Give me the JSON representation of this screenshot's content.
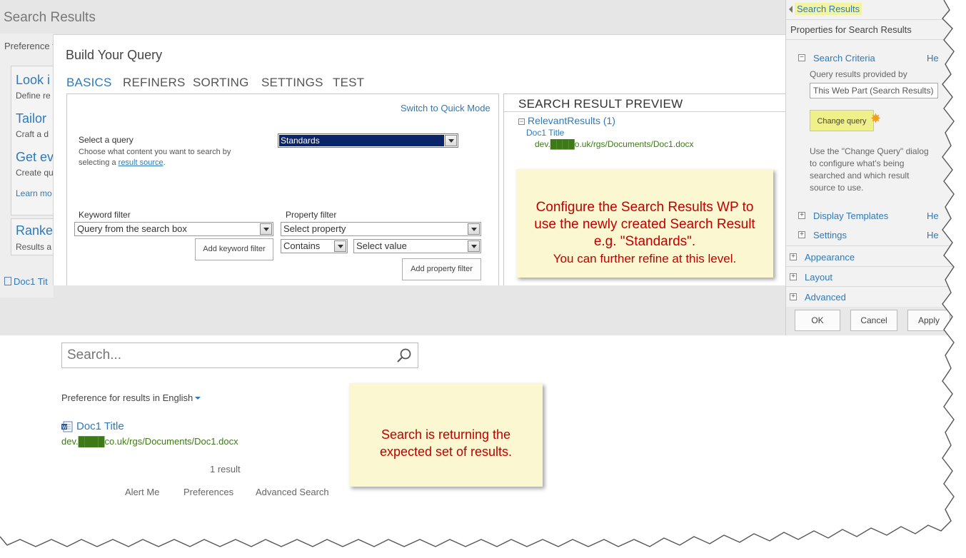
{
  "background_page": {
    "title": "Search Results",
    "preference_label": "Preference f",
    "cards": [
      {
        "heading": "Look i",
        "sub": "Define re"
      },
      {
        "heading": "Tailor",
        "sub": "Craft a d"
      },
      {
        "heading": "Get ev",
        "sub": "Create qu"
      }
    ],
    "learn_more": "Learn mo",
    "rank_heading": "Ranke",
    "rank_sub": "Results a",
    "doc_link": "Doc1 Tit"
  },
  "dialog": {
    "title": "Build Your Query",
    "tabs": [
      {
        "label": "BASICS",
        "active": true
      },
      {
        "label": "REFINERS",
        "active": false
      },
      {
        "label": "SORTING",
        "active": false
      },
      {
        "label": "SETTINGS",
        "active": false
      },
      {
        "label": "TEST",
        "active": false
      }
    ],
    "switch_mode": "Switch to Quick Mode",
    "select_query_label": "Select a query",
    "select_query_desc": "Choose what content you want to search by selecting a",
    "result_source_link": "result source",
    "select_query_value": "Standards",
    "keyword_filter_label": "Keyword filter",
    "keyword_filter_value": "Query from the search box",
    "add_keyword_filter": "Add keyword filter",
    "property_filter_label": "Property filter",
    "property_filter_value": "Select property",
    "operator_value": "Contains",
    "value_value": "Select value",
    "add_property_filter": "Add property filter",
    "preview": {
      "title": "SEARCH RESULT PREVIEW",
      "group": "RelevantResults (1)",
      "doc_title": "Doc1 Title",
      "doc_url": "dev.████o.uk/rgs/Documents/Doc1.docx"
    }
  },
  "tool_pane": {
    "header": "Search Results",
    "properties_title": "Properties for Search Results",
    "search_criteria": "Search Criteria",
    "help_link": "He",
    "query_provided_label": "Query results provided by",
    "query_provided_value": "This Web Part (Search Results)",
    "change_query": "Change query",
    "description": "Use the \"Change Query\" dialog to configure what's being searched and which result source to use.",
    "display_templates": "Display Templates",
    "settings": "Settings",
    "appearance": "Appearance",
    "layout": "Layout",
    "advanced": "Advanced",
    "ok": "OK",
    "cancel": "Cancel",
    "apply": "Apply"
  },
  "search_page": {
    "search_placeholder": "Search...",
    "preference_text": "Preference for results in English",
    "result_title": "Doc1 Title",
    "result_url": "dev.████co.uk/rgs/Documents/Doc1.docx",
    "result_count": "1 result",
    "footer_links": [
      "Alert Me",
      "Preferences",
      "Advanced Search"
    ]
  },
  "notes": {
    "note1_line1": "Configure the Search Results WP to",
    "note1_line2": "use the newly created Search Result",
    "note1_line3": "e.g. \"Standards\".",
    "note1_line4": "You can further refine at this level.",
    "note2_line1": "Search is returning the",
    "note2_line2": "expected set of results."
  },
  "colors": {
    "link_blue": "#2f79b8",
    "url_green": "#3d7a17",
    "note_text": "#c00000",
    "note_bg": "#fbf7d0",
    "highlight_yellow": "#f4f4a0"
  }
}
